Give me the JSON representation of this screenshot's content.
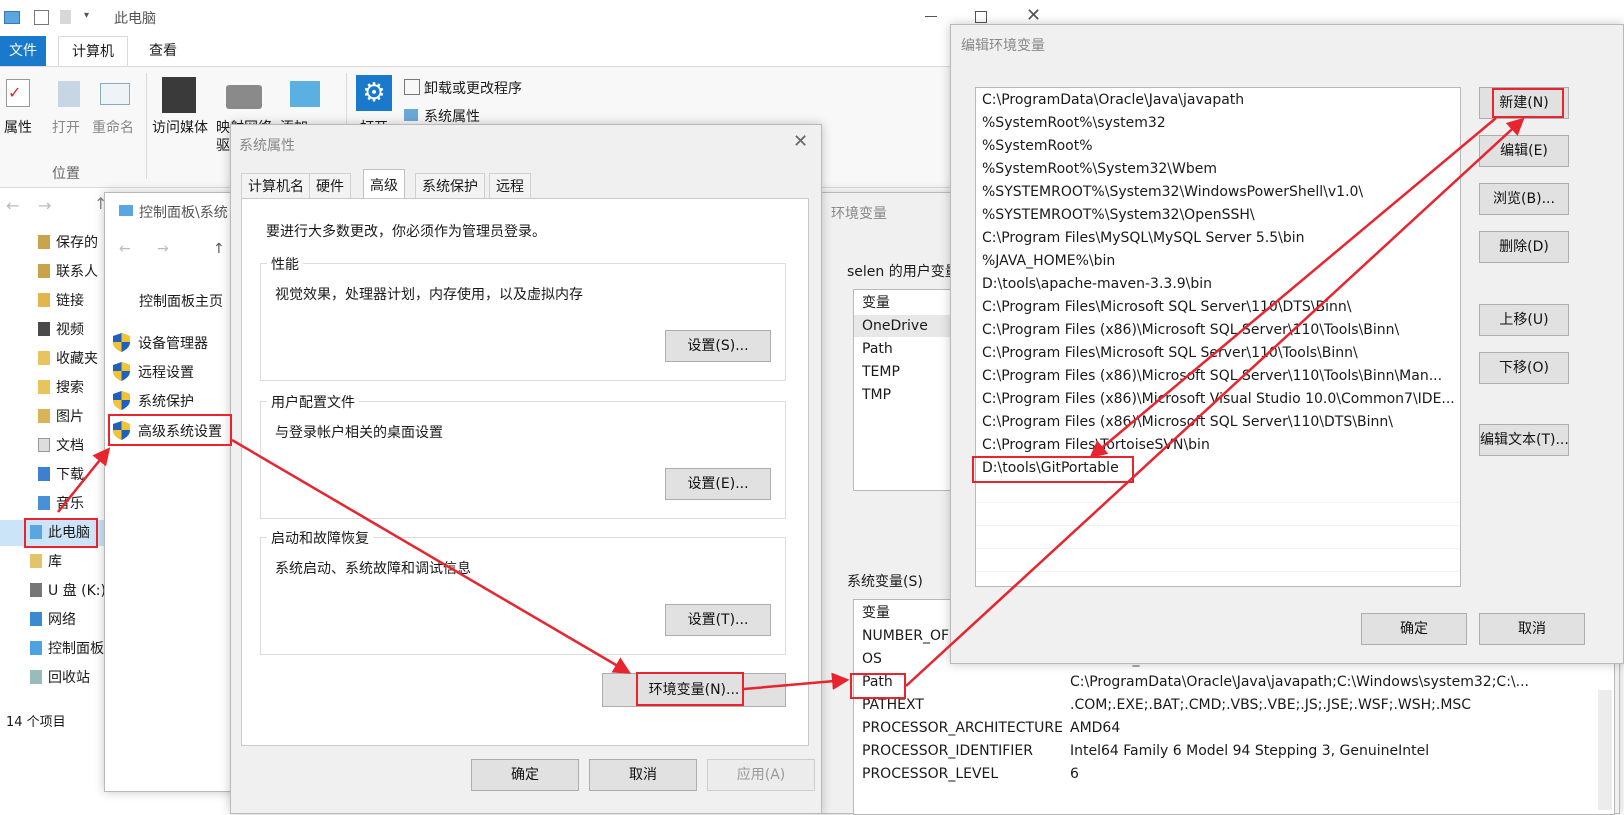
{
  "explorer": {
    "title": "此电脑",
    "ribbon_tabs": [
      "文件",
      "计算机",
      "查看"
    ],
    "ribbon_items": {
      "properties": "属性",
      "open": "打开",
      "rename": "重命名",
      "access_media": "访问媒体",
      "map_network_line1": "映射网络",
      "map_network_line2": "驱",
      "add_network": "添加一",
      "open2": "打开",
      "uninstall": "卸载或更改程序",
      "system_properties": "系统属性"
    },
    "group_location": "位置",
    "nav_items": [
      "保存的",
      "联系人",
      "链接",
      "视频",
      "收藏夹",
      "搜索",
      "图片",
      "文档",
      "下载",
      "音乐",
      "此电脑",
      "库",
      "U 盘 (K:)",
      "网络",
      "控制面板",
      "回收站"
    ],
    "status": "14 个项目"
  },
  "control_panel": {
    "address": "控制面板\\系统",
    "home": "控制面板主页",
    "links": [
      "设备管理器",
      "远程设置",
      "系统保护",
      "高级系统设置"
    ]
  },
  "sysprops": {
    "title": "系统属性",
    "tabs": [
      "计算机名",
      "硬件",
      "高级",
      "系统保护",
      "远程"
    ],
    "admin_note": "要进行大多数更改，你必须作为管理员登录。",
    "performance": {
      "title": "性能",
      "desc": "视觉效果，处理器计划，内存使用，以及虚拟内存",
      "button": "设置(S)..."
    },
    "profiles": {
      "title": "用户配置文件",
      "desc": "与登录帐户相关的桌面设置",
      "button": "设置(E)..."
    },
    "startup": {
      "title": "启动和故障恢复",
      "desc": "系统启动、系统故障和调试信息",
      "button": "设置(T)..."
    },
    "env_button": "环境变量(N)...",
    "ok": "确定",
    "cancel": "取消",
    "apply": "应用(A)"
  },
  "envvars": {
    "title": "环境变量",
    "user_section": "selen 的用户变量",
    "user_header": "变量",
    "user_vars": [
      "OneDrive",
      "Path",
      "TEMP",
      "TMP"
    ],
    "sys_section": "系统变量(S)",
    "sys_header": "变量",
    "sys_vars": [
      {
        "name": "NUMBER_OF",
        "value": ""
      },
      {
        "name": "OS",
        "value": "Windows_NT"
      },
      {
        "name": "Path",
        "value": "C:\\ProgramData\\Oracle\\Java\\javapath;C:\\Windows\\system32;C:\\..."
      },
      {
        "name": "PATHEXT",
        "value": ".COM;.EXE;.BAT;.CMD;.VBS;.VBE;.JS;.JSE;.WSF;.WSH;.MSC"
      },
      {
        "name": "PROCESSOR_ARCHITECTURE",
        "value": "AMD64"
      },
      {
        "name": "PROCESSOR_IDENTIFIER",
        "value": "Intel64 Family 6 Model 94 Stepping 3, GenuineIntel"
      },
      {
        "name": "PROCESSOR_LEVEL",
        "value": "6"
      }
    ]
  },
  "editenv": {
    "title": "编辑环境变量",
    "paths": [
      "C:\\ProgramData\\Oracle\\Java\\javapath",
      "%SystemRoot%\\system32",
      "%SystemRoot%",
      "%SystemRoot%\\System32\\Wbem",
      "%SYSTEMROOT%\\System32\\WindowsPowerShell\\v1.0\\",
      "%SYSTEMROOT%\\System32\\OpenSSH\\",
      "C:\\Program Files\\MySQL\\MySQL Server 5.5\\bin",
      "%JAVA_HOME%\\bin",
      "D:\\tools\\apache-maven-3.3.9\\bin",
      "C:\\Program Files\\Microsoft SQL Server\\110\\DTS\\Binn\\",
      "C:\\Program Files (x86)\\Microsoft SQL Server\\110\\Tools\\Binn\\",
      "C:\\Program Files\\Microsoft SQL Server\\110\\Tools\\Binn\\",
      "C:\\Program Files (x86)\\Microsoft SQL Server\\110\\Tools\\Binn\\Man...",
      "C:\\Program Files (x86)\\Microsoft Visual Studio 10.0\\Common7\\IDE...",
      "C:\\Program Files (x86)\\Microsoft SQL Server\\110\\DTS\\Binn\\",
      "C:\\Program Files\\TortoiseSVN\\bin",
      "D:\\tools\\GitPortable"
    ],
    "buttons": {
      "new": "新建(N)",
      "edit": "编辑(E)",
      "browse": "浏览(B)...",
      "delete": "删除(D)",
      "up": "上移(U)",
      "down": "下移(O)",
      "edit_text": "编辑文本(T)..."
    },
    "ok": "确定",
    "cancel": "取消"
  },
  "colors": {
    "highlight": "#e8242f",
    "accent": "#0078d7",
    "shield_blue": "#1f5fbf",
    "shield_yellow": "#f4c430"
  }
}
